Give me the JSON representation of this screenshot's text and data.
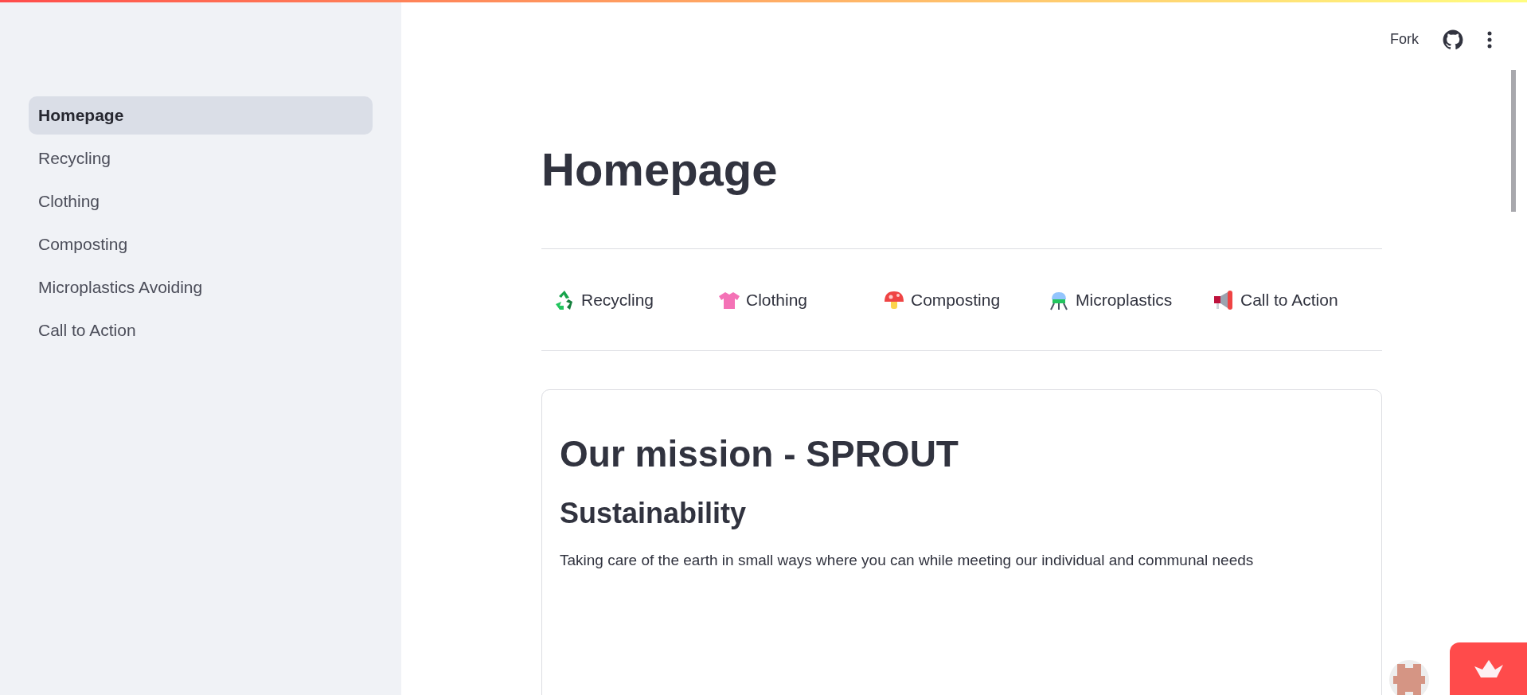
{
  "sidebar": {
    "items": [
      {
        "label": "Homepage",
        "selected": true
      },
      {
        "label": "Recycling",
        "selected": false
      },
      {
        "label": "Clothing",
        "selected": false
      },
      {
        "label": "Composting",
        "selected": false
      },
      {
        "label": "Microplastics Avoiding",
        "selected": false
      },
      {
        "label": "Call to Action",
        "selected": false
      }
    ]
  },
  "toolbar": {
    "fork": "Fork"
  },
  "page": {
    "title": "Homepage",
    "links": [
      {
        "kind": "recycle",
        "label": "Recycling"
      },
      {
        "kind": "shirt",
        "label": "Clothing"
      },
      {
        "kind": "mushroom",
        "label": "Composting"
      },
      {
        "kind": "microscope",
        "label": "Microplastics"
      },
      {
        "kind": "megaphone",
        "label": "Call to Action"
      }
    ],
    "card": {
      "heading": "Our mission - SPROUT",
      "subheading": "Sustainability",
      "text": "Taking care of the earth in small ways where you can while meeting our individual and communal needs"
    }
  }
}
